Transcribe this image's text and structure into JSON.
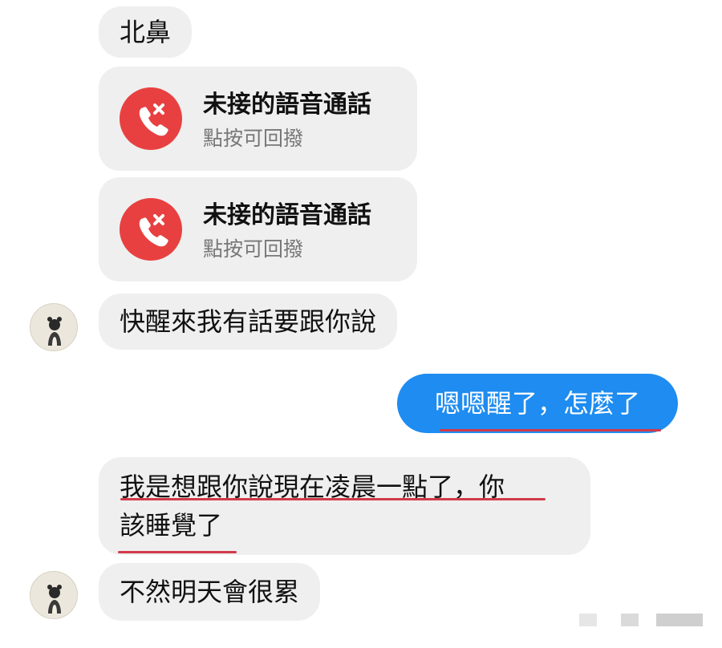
{
  "messages": {
    "first": "北鼻",
    "calls": [
      {
        "title": "未接的語音通話",
        "subtitle": "點按可回撥"
      },
      {
        "title": "未接的語音通話",
        "subtitle": "點按可回撥"
      }
    ],
    "wake": "快醒來我有話要跟你說",
    "reply": "嗯嗯醒了，怎麼了",
    "explain_line1": "我是想跟你說現在凌晨一點了，你",
    "explain_line2": "該睡覺了",
    "last": "不然明天會很累"
  },
  "colors": {
    "incoming_bubble": "#efefef",
    "outgoing_bubble": "#1e8cf0",
    "missed_call_icon": "#e84040",
    "underline": "#d23a4a"
  },
  "icons": {
    "missed_call": "missed-call-icon",
    "avatar": "avatar-icon"
  }
}
